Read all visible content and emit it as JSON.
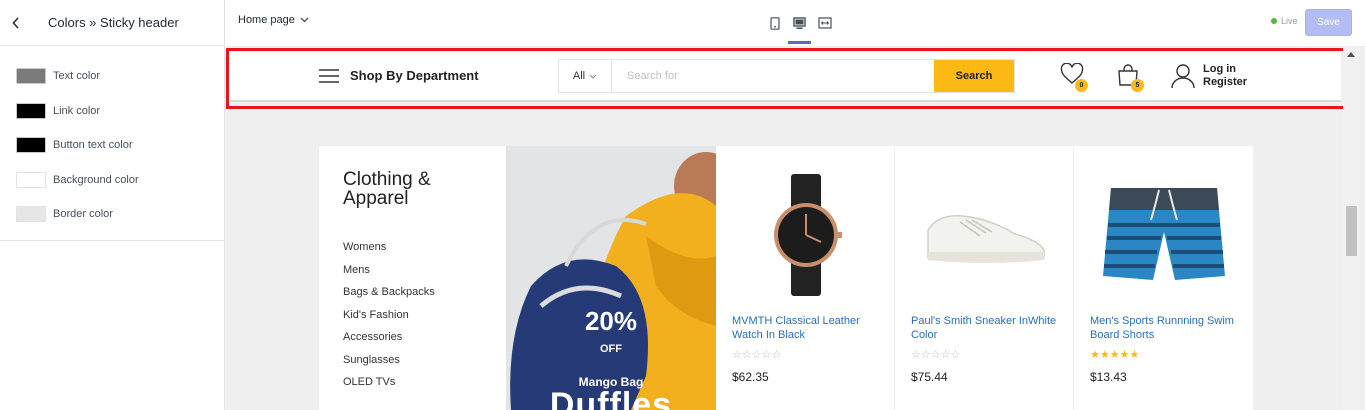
{
  "panel": {
    "title": "Colors » Sticky header",
    "colors": [
      {
        "label": "Text color",
        "hex": "#7a7a7a"
      },
      {
        "label": "Link color",
        "hex": "#000000"
      },
      {
        "label": "Button text color",
        "hex": "#000000"
      },
      {
        "label": "Background color",
        "hex": "#ffffff"
      },
      {
        "label": "Border color",
        "hex": "#e6e6e6"
      }
    ]
  },
  "toolbar": {
    "page_select": "Home page",
    "live_label": "Live",
    "save_label": "Save",
    "devices": [
      "mobile-icon",
      "desktop-icon",
      "fullscreen-icon"
    ],
    "active_device": "desktop-icon"
  },
  "store_header": {
    "department_label": "Shop By Department",
    "search_category": "All",
    "search_placeholder": "Search for",
    "search_button": "Search",
    "wishlist_count": "0",
    "cart_count": "5",
    "login_label": "Log in",
    "register_label": "Register"
  },
  "category": {
    "title_line1": "Clothing &",
    "title_line2": "Apparel",
    "items": [
      "Womens",
      "Mens",
      "Bags & Backpacks",
      "Kid's Fashion",
      "Accessories",
      "Sunglasses",
      "OLED TVs"
    ]
  },
  "banner": {
    "discount": "20%",
    "off": "OFF",
    "subtitle": "Mango Bag",
    "title": "Duffles"
  },
  "products": [
    {
      "name": "MVMTH Classical Leather Watch In Black",
      "price": "$62.35",
      "rating": 0
    },
    {
      "name": "Paul's Smith Sneaker InWhite Color",
      "price": "$75.44",
      "rating": 0
    },
    {
      "name": "Men's Sports Runnning Swim Board Shorts",
      "price": "$13.43",
      "rating": 5
    }
  ],
  "colors": {
    "accent": "#fdb913",
    "highlight": "#e8141e",
    "link": "#2a6db8",
    "save_button": "#b3bcf5"
  }
}
